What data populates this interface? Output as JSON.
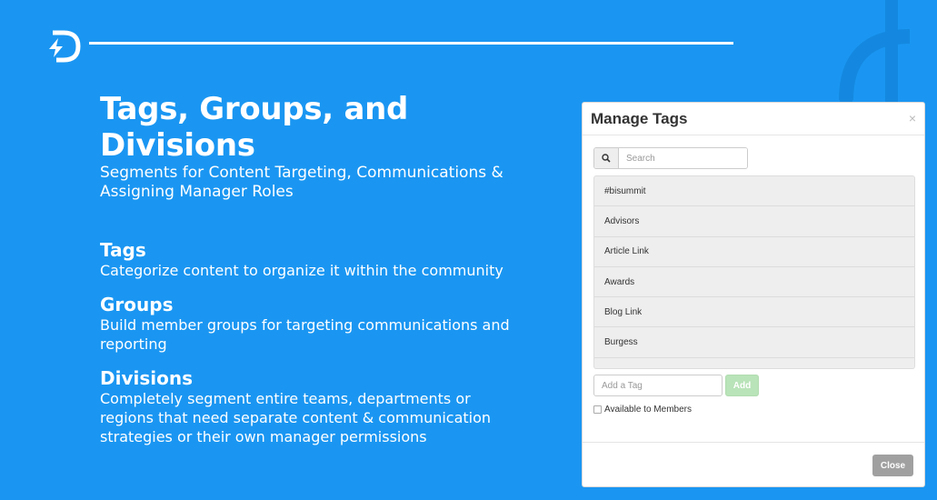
{
  "slide": {
    "title": "Tags, Groups, and Divisions",
    "subtitle_line1": "Segments for Content Targeting, Communications &",
    "subtitle_line2": "Assigning Manager Roles",
    "sections": [
      {
        "heading": "Tags",
        "lines": [
          "Categorize content to organize it within the community"
        ]
      },
      {
        "heading": "Groups",
        "lines": [
          "Build member groups for targeting communications and",
          "reporting"
        ]
      },
      {
        "heading": "Divisions",
        "lines": [
          "Completely segment entire teams, departments or",
          "regions that need separate content & communication",
          "strategies or their own manager permissions"
        ]
      }
    ]
  },
  "modal": {
    "title": "Manage Tags",
    "close_x": "×",
    "search": {
      "placeholder": "Search",
      "icon": "search-icon"
    },
    "tags": [
      "#bisummit",
      "Advisors",
      "Article Link",
      "Awards",
      "Blog Link",
      "Burgess"
    ],
    "add_tag": {
      "placeholder": "Add a Tag",
      "button_label": "Add"
    },
    "available_label": "Available to Members",
    "close_label": "Close"
  },
  "colors": {
    "background": "#1a96f2",
    "add_button": "#b9e3b9",
    "close_button": "#a0a0a0"
  }
}
